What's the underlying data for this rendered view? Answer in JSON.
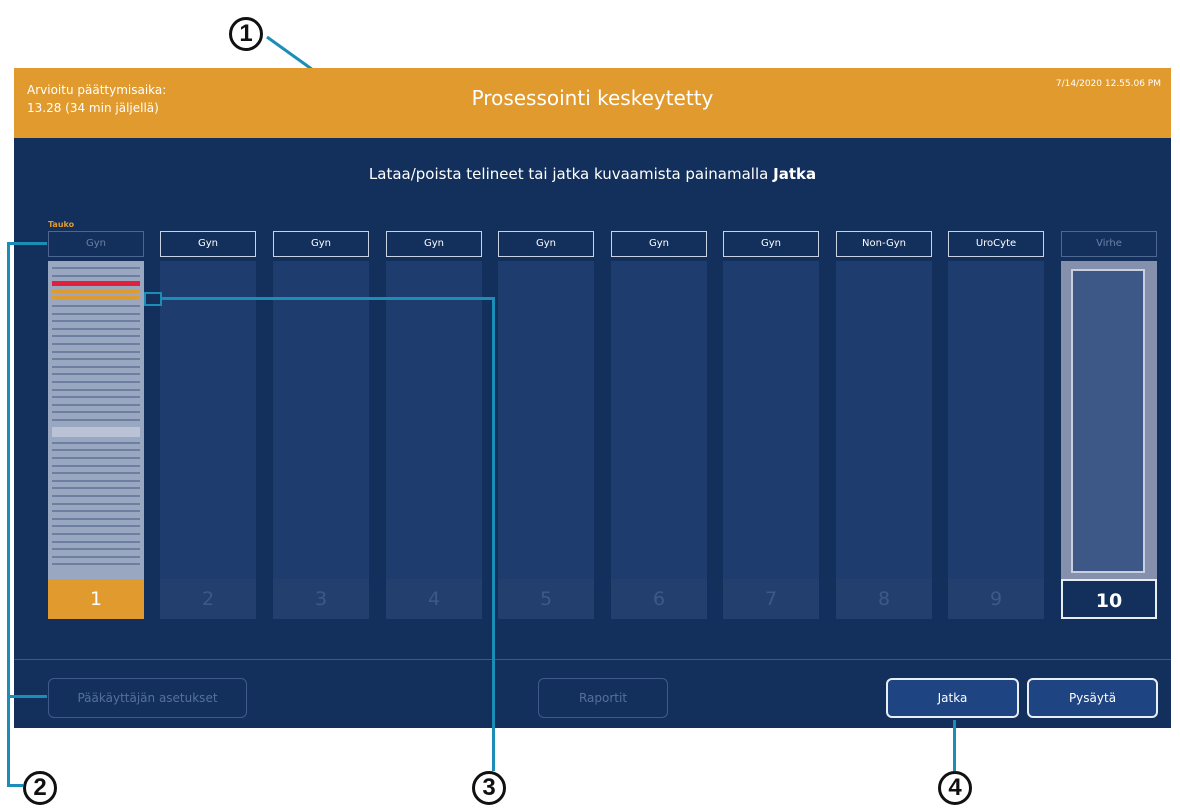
{
  "callouts": [
    "1",
    "2",
    "3",
    "4"
  ],
  "header": {
    "eta_label": "Arvioitu päättymisaika:",
    "eta_value": "13.28 (34 min jäljellä)",
    "title": "Prosessointi keskeytetty",
    "timestamp": "7/14/2020 12.55.06 PM"
  },
  "instruction": {
    "text": "Lataa/poista telineet tai jatka kuvaamista painamalla",
    "bold": "Jatka"
  },
  "pause_label": "Tauko",
  "slots": [
    {
      "label": "Gyn",
      "number": "1"
    },
    {
      "label": "Gyn",
      "number": "2"
    },
    {
      "label": "Gyn",
      "number": "3"
    },
    {
      "label": "Gyn",
      "number": "4"
    },
    {
      "label": "Gyn",
      "number": "5"
    },
    {
      "label": "Gyn",
      "number": "6"
    },
    {
      "label": "Gyn",
      "number": "7"
    },
    {
      "label": "Non-Gyn",
      "number": "8"
    },
    {
      "label": "UroCyte",
      "number": "9"
    },
    {
      "label": "Virhe",
      "number": "10"
    }
  ],
  "buttons": {
    "admin": "Pääkäyttäjän asetukset",
    "reports": "Raportit",
    "continue": "Jatka",
    "stop": "Pysäytä"
  },
  "colors": {
    "header": "#e19a2d",
    "screen_bg": "#13305c",
    "slide_red": "#e0213b",
    "slide_orange": "#e19a2d",
    "guide_line": "#1b8db6"
  }
}
